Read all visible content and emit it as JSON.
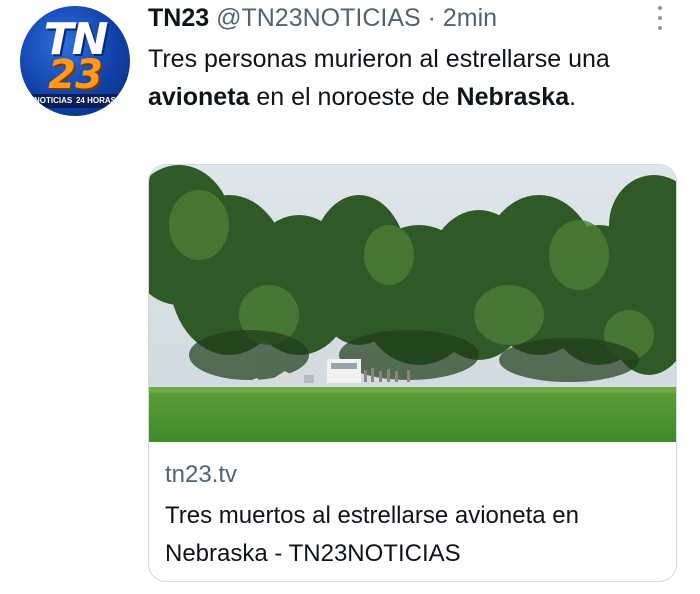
{
  "tweet": {
    "author_name": "TN23",
    "handle": "@TN23NOTICIAS",
    "separator": " · ",
    "time": "2min",
    "text_part1": "Tres personas murieron al estrellarse una ",
    "text_bold1": "avioneta",
    "text_part2": " en el noroeste de ",
    "text_bold2": "Nebraska",
    "text_part3": "."
  },
  "avatar": {
    "logo_line1": "TN",
    "logo_line2": "23",
    "strip_left": "NOTICIAS",
    "strip_right": "24 HORAS"
  },
  "card": {
    "domain": "tn23.tv",
    "title": "Tres muertos al estrellarse avioneta en Nebraska - TN23NOTICIAS",
    "image": "plane-crash-photo"
  },
  "icons": {
    "more": "more-vertical-icon"
  }
}
